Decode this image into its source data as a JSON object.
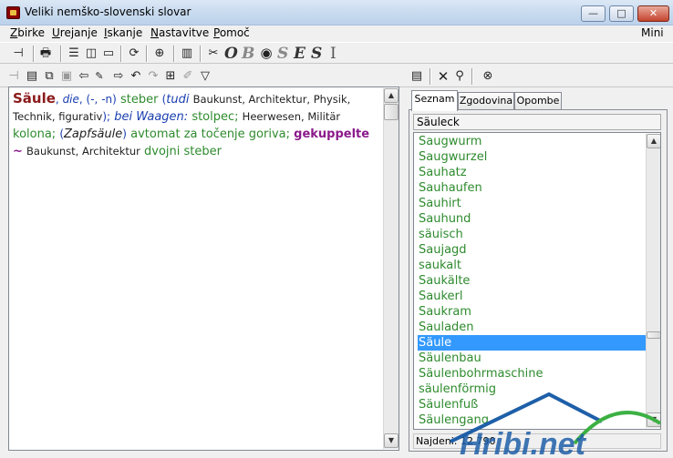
{
  "window": {
    "title": "Veliki nemško-slovenski slovar",
    "min_glyph": "—",
    "max_glyph": "□",
    "close_glyph": "✕"
  },
  "menu": {
    "items": [
      {
        "u": "Z",
        "rest": "birke"
      },
      {
        "u": "U",
        "rest": "rejanje"
      },
      {
        "u": "I",
        "rest": "skanje"
      },
      {
        "u": "N",
        "rest": "astavitve"
      },
      {
        "u": "P",
        "rest": "omoč"
      }
    ],
    "mini": "Mini"
  },
  "toolbar": {
    "letters": [
      "O",
      "B",
      "S",
      "E",
      "S",
      "I"
    ]
  },
  "entry": {
    "headword": "Säule",
    "gender": "die",
    "inflection": "(-, -n)",
    "sense1": "steber",
    "tudi_open": "(",
    "tudi": "tudi",
    "domains1": "Baukunst, Architektur, Physik, Technik, figurativ",
    "close_semicolon": ");",
    "bei_waagen": "bei Waagen:",
    "sense2": "stolpec;",
    "domains2": "Heerwesen, Militär",
    "sense3": "kolona;",
    "zapf_open": "(",
    "zapfsaule": "Zapfsäule",
    "zapf_close": ")",
    "sense4": "avtomat za točenje goriva;",
    "phrase": "gekuppelte ~",
    "domains3": "Baukunst, Architektur",
    "sense5": "dvojni steber"
  },
  "tabs": [
    "Seznam",
    "Zgodovina",
    "Opombe"
  ],
  "search": {
    "value": "Säuleck"
  },
  "word_list": {
    "items": [
      "Saugwurm",
      "Saugwurzel",
      "Sauhatz",
      "Sauhaufen",
      "Sauhirt",
      "Sauhund",
      "säuisch",
      "Saujagd",
      "saukalt",
      "Saukälte",
      "Saukerl",
      "Saukram",
      "Sauladen",
      "Säule",
      "Säulenbau",
      "Säulenbohrmaschine",
      "säulenförmig",
      "Säulenfuß",
      "Säulengang"
    ],
    "selected": "Säule"
  },
  "status": {
    "text": "Najdeni: 12 790"
  },
  "watermark": {
    "text": "Hribi.net"
  },
  "colors": {
    "headword": "#8b1a1a",
    "translation": "#2e8b2e",
    "grammar": "#1a3fb0",
    "phrase": "#8b1a8b",
    "selection": "#3399ff"
  }
}
